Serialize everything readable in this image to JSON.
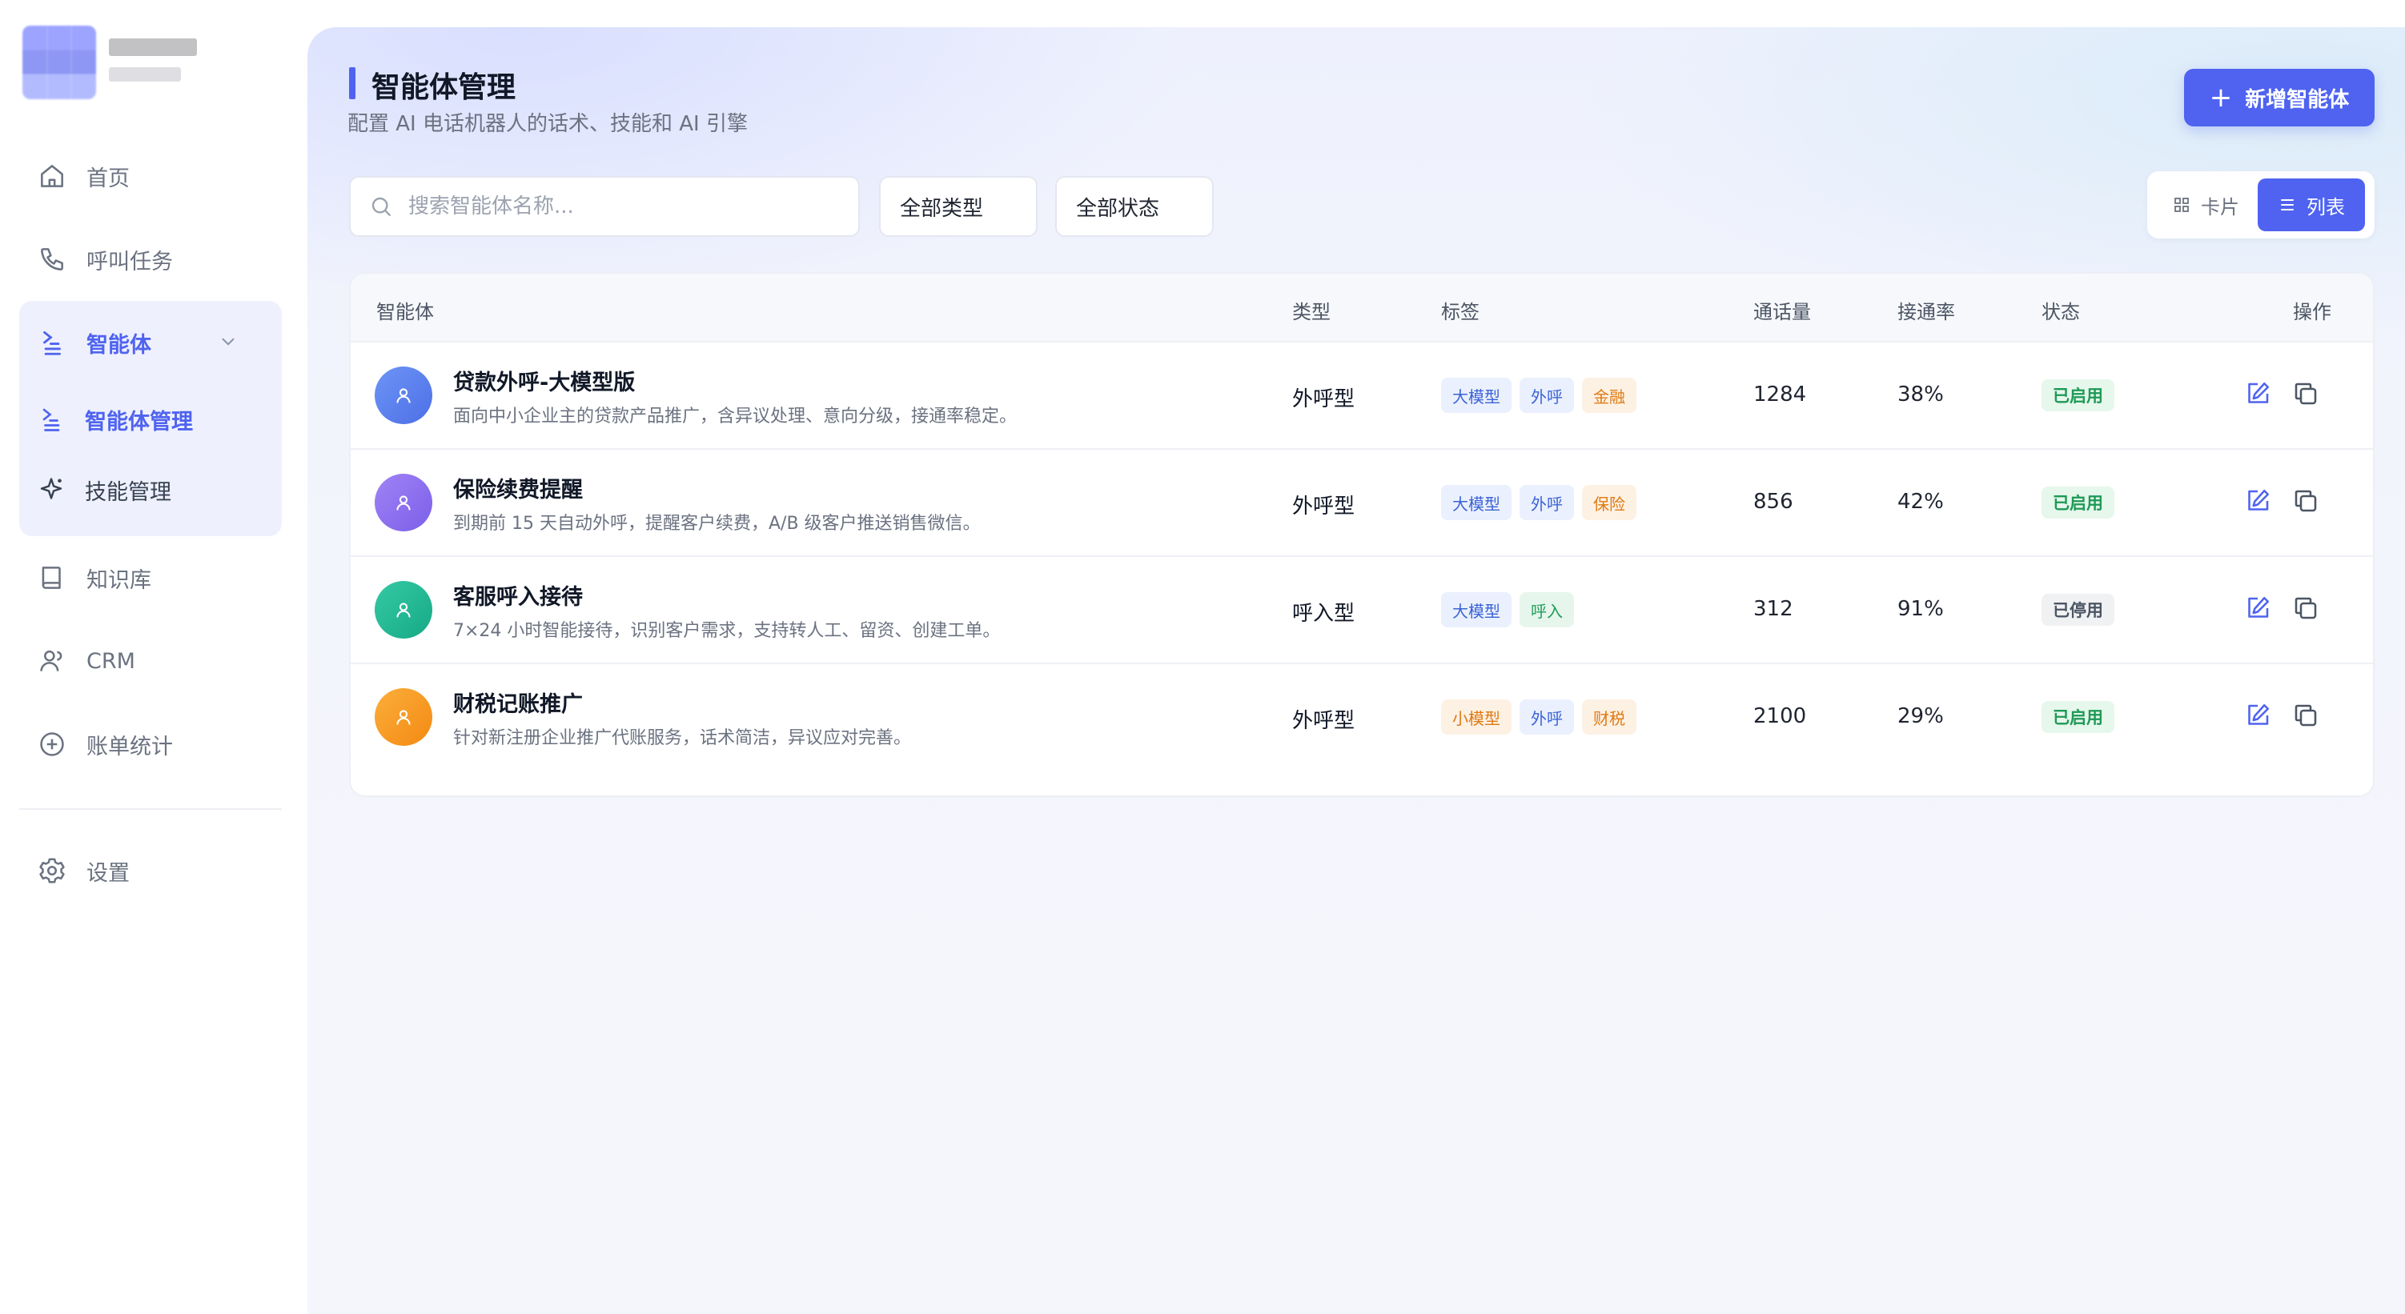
{
  "colors": {
    "accent": "#4f63f0",
    "status_on": "#1d9a55",
    "avatar_1": "#5b82f0",
    "avatar_2": "#8b6cf0",
    "avatar_3": "#22b897",
    "avatar_4": "#f59a1b"
  },
  "sidebar": {
    "items": [
      {
        "label": "首页",
        "icon": "home-icon"
      },
      {
        "label": "呼叫任务",
        "icon": "phone-icon"
      },
      {
        "label": "智能体",
        "icon": "agent-icon",
        "expanded": true,
        "children": [
          {
            "label": "智能体管理",
            "icon": "agent-icon",
            "active": true
          },
          {
            "label": "技能管理",
            "icon": "sparkle-icon"
          }
        ]
      },
      {
        "label": "知识库",
        "icon": "book-icon"
      },
      {
        "label": "CRM",
        "icon": "user-icon"
      },
      {
        "label": "账单统计",
        "icon": "plus-circle-icon"
      }
    ],
    "settings": {
      "label": "设置",
      "icon": "gear-icon"
    }
  },
  "header": {
    "title": "智能体管理",
    "subtitle": "配置 AI 电话机器人的话术、技能和 AI 引擎",
    "add_button": "新增智能体"
  },
  "filters": {
    "search_placeholder": "搜索智能体名称...",
    "type_select": "全部类型",
    "status_select": "全部状态"
  },
  "view_toggle": {
    "card": "卡片",
    "list": "列表",
    "selected": "列表"
  },
  "table": {
    "columns": [
      "智能体",
      "类型",
      "标签",
      "通话量",
      "接通率",
      "状态",
      "操作"
    ],
    "rows": [
      {
        "name": "贷款外呼-大模型版",
        "desc": "面向中小企业主的贷款产品推广，含异议处理、意向分级，接通率稳定。",
        "type": "外呼型",
        "tags": [
          "大模型",
          "外呼",
          "金融"
        ],
        "calls": "1284",
        "rate": "38%",
        "status": "已启用"
      },
      {
        "name": "保险续费提醒",
        "desc": "到期前 15 天自动外呼，提醒客户续费，A/B 级客户推送销售微信。",
        "type": "外呼型",
        "tags": [
          "大模型",
          "外呼",
          "保险"
        ],
        "calls": "856",
        "rate": "42%",
        "status": "已启用"
      },
      {
        "name": "客服呼入接待",
        "desc": "7×24 小时智能接待，识别客户需求，支持转人工、留资、创建工单。",
        "type": "呼入型",
        "tags": [
          "大模型",
          "呼入"
        ],
        "calls": "312",
        "rate": "91%",
        "status": "已停用"
      },
      {
        "name": "财税记账推广",
        "desc": "针对新注册企业推广代账服务，话术简洁，异议应对完善。",
        "type": "外呼型",
        "tags": [
          "小模型",
          "外呼",
          "财税"
        ],
        "calls": "2100",
        "rate": "29%",
        "status": "已启用"
      }
    ]
  }
}
